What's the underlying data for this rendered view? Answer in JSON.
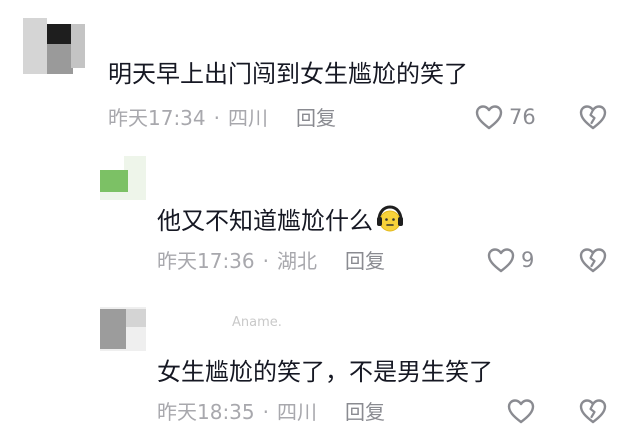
{
  "comments": [
    {
      "username": "",
      "text": "明天早上出门闯到女生尴尬的笑了",
      "time": "昨天17:34",
      "separator": "·",
      "location": "四川",
      "reply_label": "回复",
      "likes": "76",
      "avatar_colors": [
        "#3a3a3a",
        "#9c9c9c",
        "#d7d7d7",
        "#5b5b5b"
      ]
    },
    {
      "username": "",
      "text": "他又不知道尴尬什么",
      "emoji": "headphone-face-emoji",
      "time": "昨天17:36",
      "separator": "·",
      "location": "湖北",
      "reply_label": "回复",
      "likes": "9",
      "avatar_colors": [
        "#7fc36a",
        "#ffffff",
        "#e9f3e4"
      ]
    },
    {
      "username": "Aname.",
      "text": "女生尴尬的笑了，不是男生笑了",
      "time": "昨天18:35",
      "separator": "·",
      "location": "四川",
      "reply_label": "回复",
      "likes": "",
      "avatar_colors": [
        "#9a9a9a",
        "#d9d9d9",
        "#efefef"
      ]
    }
  ],
  "icons": {
    "like": "heart-outline-icon",
    "dislike": "broken-heart-icon"
  },
  "colors": {
    "text": "#161823",
    "meta": "#a8a8ad",
    "icon": "#8a8b91",
    "emoji_face": "#f7d23a"
  }
}
